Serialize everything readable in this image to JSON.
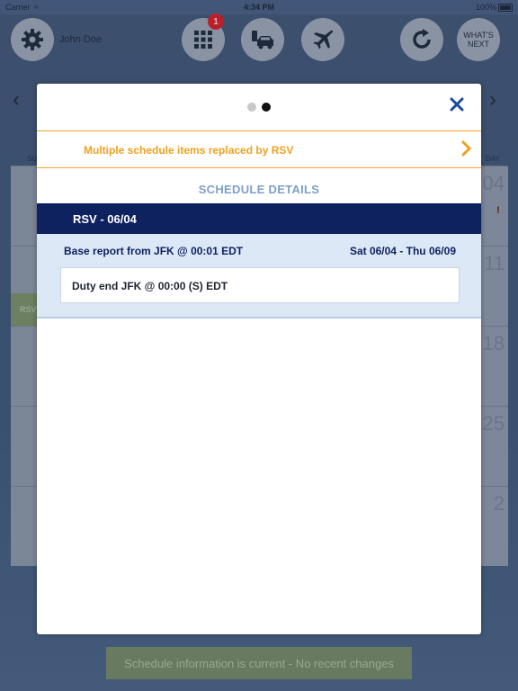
{
  "status_bar": {
    "carrier": "Carrier",
    "time": "4:34 PM",
    "battery": "100%"
  },
  "header": {
    "user_name": "John Doe",
    "badge_count": "1",
    "whats_next_line1": "WHAT'S",
    "whats_next_line2": "NEXT"
  },
  "calendar": {
    "header_left": "SU",
    "header_right": "DAY",
    "days": [
      "04",
      "11",
      "18",
      "25",
      "2"
    ],
    "rsv_label": "RSV"
  },
  "modal": {
    "alert_text": "Multiple schedule items replaced by RSV",
    "section_title": "SCHEDULE DETAILS",
    "rsv_title": "RSV - 06/04",
    "base_report": "Base report from JFK @ 00:01 EDT",
    "date_range": "Sat 06/04 - Thu 06/09",
    "duty_end": "Duty end JFK @ 00:00 (S) EDT"
  },
  "footer": {
    "status_banner": "Schedule information is current - No recent changes"
  },
  "colors": {
    "navy": "#0f2260",
    "accent_orange": "#eda21e",
    "close_blue": "#1a4aa0",
    "panel_blue": "#dce8f6"
  },
  "icons": [
    "gear-icon",
    "grid-icon",
    "car-icon",
    "plane-icon",
    "refresh-icon",
    "close-icon",
    "chevron-right-icon"
  ]
}
